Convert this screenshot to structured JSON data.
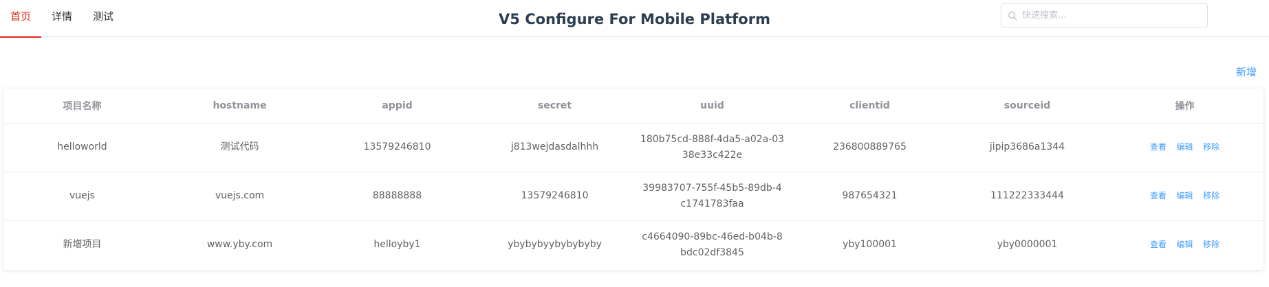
{
  "nav": {
    "items": [
      {
        "label": "首页"
      },
      {
        "label": "详情"
      },
      {
        "label": "测试"
      }
    ]
  },
  "header": {
    "title": "V5 Configure For Mobile Platform"
  },
  "search": {
    "placeholder": "快速搜索..."
  },
  "actions": {
    "add_label": "新增"
  },
  "table": {
    "headers": [
      "项目名称",
      "hostname",
      "appid",
      "secret",
      "uuid",
      "clientid",
      "sourceid",
      "操作"
    ],
    "rows": [
      {
        "name": "helloworld",
        "hostname": "测试代码",
        "appid": "13579246810",
        "secret": "j813wejdasdalhhh",
        "uuid": "180b75cd-888f-4da5-a02a-0338e33c422e",
        "clientid": "236800889765",
        "sourceid": "jipip3686a1344"
      },
      {
        "name": "vuejs",
        "hostname": "vuejs.com",
        "appid": "88888888",
        "secret": "13579246810",
        "uuid": "39983707-755f-45b5-89db-4c1741783faa",
        "clientid": "987654321",
        "sourceid": "111222333444"
      },
      {
        "name": "新增项目",
        "hostname": "www.yby.com",
        "appid": "helloyby1",
        "secret": "ybybybyybybybyby",
        "uuid": "c4664090-89bc-46ed-b04b-8bdc02df3845",
        "clientid": "yby100001",
        "sourceid": "yby0000001"
      }
    ],
    "ops": {
      "view": "查看",
      "edit": "编辑",
      "remove": "移除"
    }
  },
  "colors": {
    "accent": "#e1251b",
    "link": "#409eff",
    "title": "#2c3e50"
  }
}
